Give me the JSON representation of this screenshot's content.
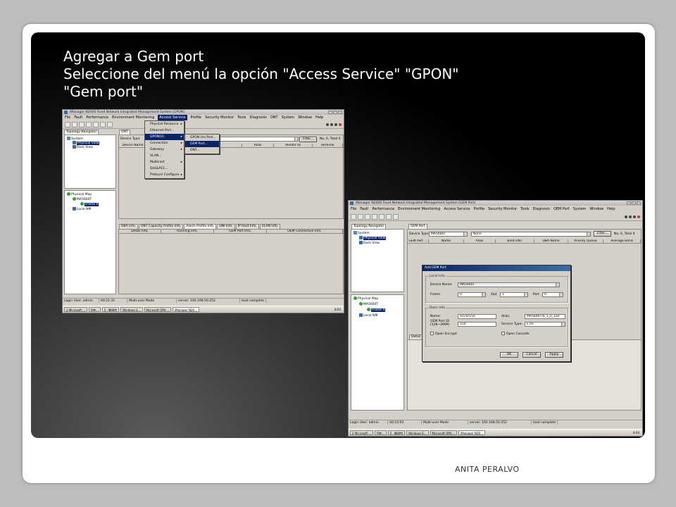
{
  "slide": {
    "title_line1": "Agregar a Gem port",
    "title_line2": "Seleccione del menú la opción \"Access Service\"  \"GPON\" ",
    "title_line3": "\"Gem port\"",
    "author": "ANITA PERALVO"
  },
  "window1": {
    "title": "iManager N2000 Fixed Network Integrated Management System [GPON]",
    "menu": [
      "File",
      "Fault",
      "Performance",
      "Environment Monitoring",
      "Access Service",
      "Profile",
      "Security Monitor",
      "Tools",
      "Diagnosis",
      "ONT",
      "System",
      "Window",
      "Help"
    ],
    "left_tab": "Topology Navigator",
    "tree_top": [
      "System",
      "Physical View",
      "Rack View"
    ],
    "tree_bottom": [
      "Physical Map",
      "MA5600T",
      "Frame 0",
      "Local NM"
    ],
    "main_tab": "ONT",
    "device_type_label": "Device Type:",
    "filter_button": "Filter...",
    "count_text": "No. 0, Total 0",
    "columns": [
      "Device Name",
      "Name",
      "Alias",
      "Vendor ID",
      "Terminal"
    ],
    "dropdown_access": [
      "Physical Resource",
      "Ethernet Port...",
      "GPON(H)",
      "Connection",
      "Gateway",
      "VLAN...",
      "Multicast",
      "QoS&ACL...",
      "Protocol Configure"
    ],
    "dropdown_gpon": [
      "GPON Uni Port...",
      "GEM Port...",
      "ONT..."
    ],
    "bottom_tabs": [
      "DBA Info.",
      "ONT Capacity Profile Info.",
      "Alarm Profile Info.",
      "UNI Info.",
      "IP Host Info.",
      "VLAN Info."
    ],
    "bottom_columns": [
      "Detail Info.",
      "Running Info.",
      "GEM Port Info.",
      "OEM Connection Info."
    ],
    "status": [
      "Login User: admin",
      "00:21:31",
      "Multi-user Mode",
      "server: 192.168.50.252",
      "load complete"
    ],
    "taskbar": [
      "2 Microsoft ...",
      "R使...",
      "5 · 翻译特",
      "Windows E...",
      "Microsoft Offic...",
      "iManager N20..."
    ],
    "clock": "8:02"
  },
  "window2": {
    "title": "iManager N2000 Fixed Network Integrated Management System [GEM Port]",
    "menu": [
      "File",
      "Fault",
      "Performance",
      "Environment Monitoring",
      "Access Service",
      "Profile",
      "Security Monitor",
      "Tools",
      "Diagnosis",
      "OEM Port",
      "System",
      "Window",
      "Help"
    ],
    "left_tab": "Topology Navigator",
    "tree_top": [
      "System",
      "Physical View",
      "Rack View"
    ],
    "tree_bottom": [
      "Physical Map",
      "MA5600T",
      "Frame 0",
      "Local NM"
    ],
    "main_tab": "OEM Port",
    "device_type_label": "Device Type:",
    "device_value": "MA5600T",
    "none_value": "None",
    "filter_button": "Filter...",
    "count_text": "No. 0, Total 0",
    "columns": [
      "GEM Port ...",
      "Name",
      "Alias",
      "Bind ONT",
      "DBA Name",
      "Priority Queue",
      "Average Band"
    ],
    "detail_tab": "Detail",
    "status": [
      "Login User: admin",
      "00:23:03",
      "Multi-user Mode",
      "server: 192.168.50.252",
      "load complete"
    ],
    "taskbar": [
      "2 Microsoft ...",
      "R使...",
      "5 · 翻译特",
      "Windows E...",
      "Microsoft Offic...",
      "iManager N20..."
    ],
    "clock": "8:04"
  },
  "dialog": {
    "title": "Add GEM Port",
    "local_info": "Local Info.",
    "device_name_label": "Device Name:",
    "device_name_value": "MA5600T",
    "frame_label": "Frame",
    "frame_value": "0",
    "slot_label": "Slot",
    "slot_value": "1",
    "port_label": "Port",
    "port_value": "0",
    "basic_info": "Basic Info.",
    "name_label": "Name:",
    "name_value": "0/1/0/150",
    "alias_label": "Alias:",
    "alias_value": "MA5600T/0_1_0_150",
    "gem_port_label": "GEM Port ID",
    "gem_port_range": "(128~3999)",
    "gem_port_value": "150",
    "service_type_label": "Service Type:",
    "service_type_value": "ETH",
    "open_encrypt": "Open Encrypt",
    "open_cascade": "Open Cascade",
    "ok": "OK",
    "cancel": "Cancel",
    "apply": "Apply"
  }
}
